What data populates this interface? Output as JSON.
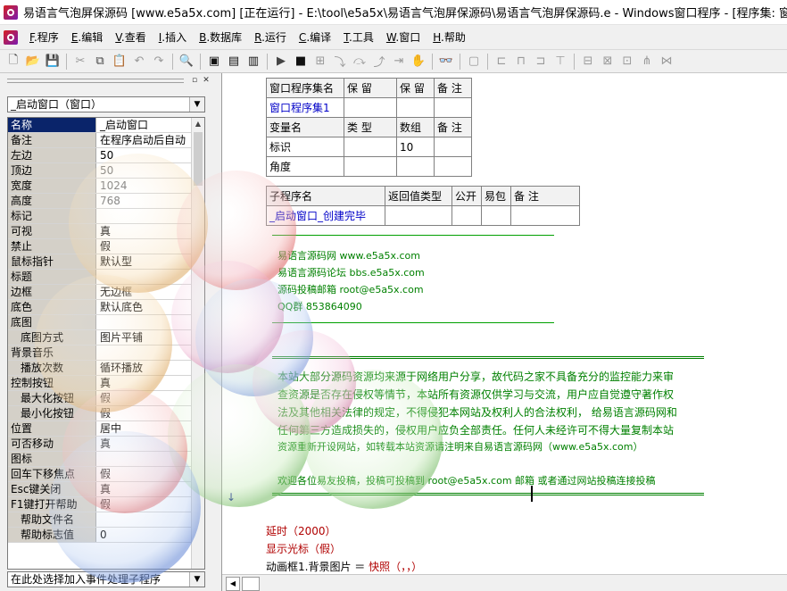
{
  "window": {
    "title": "易语言气泡屏保源码 [www.e5a5x.com] [正在运行] - E:\\tool\\e5a5x\\易语言气泡屏保源码\\易语言气泡屏保源码.e - Windows窗口程序 - [程序集: 窗口程"
  },
  "menu": [
    {
      "key": "F",
      "label": ".程序"
    },
    {
      "key": "E",
      "label": ".编辑"
    },
    {
      "key": "V",
      "label": ".查看"
    },
    {
      "key": "I",
      "label": ".插入"
    },
    {
      "key": "B",
      "label": ".数据库"
    },
    {
      "key": "R",
      "label": ".运行"
    },
    {
      "key": "C",
      "label": ".编译"
    },
    {
      "key": "T",
      "label": ".工具"
    },
    {
      "key": "W",
      "label": ".窗口"
    },
    {
      "key": "H",
      "label": ".帮助"
    }
  ],
  "toolbar_icons": [
    "new-file-icon",
    "open-file-icon",
    "save-icon",
    "cut-icon",
    "copy-icon",
    "paste-icon",
    "undo-icon",
    "redo-icon",
    "find-icon",
    "layout1-icon",
    "layout2-icon",
    "layout3-icon",
    "run-icon",
    "stop-icon",
    "step-icon",
    "step-into-icon",
    "step-over-icon",
    "step-out-icon",
    "run-to-cursor-icon",
    "hand-icon",
    "search-replace-icon",
    "form-icon",
    "align-left-icon",
    "align-center-icon",
    "align-right-icon",
    "align-top-icon",
    "same-width-icon",
    "same-height-icon",
    "same-size-icon",
    "h-space-icon",
    "v-space-icon"
  ],
  "props": {
    "object_combo": "_启动窗口（窗口）",
    "rows": [
      {
        "name": "名称",
        "value": "_启动窗口",
        "selected": true
      },
      {
        "name": "备注",
        "value": "在程序启动后自动"
      },
      {
        "name": "左边",
        "value": "50"
      },
      {
        "name": "顶边",
        "value": "50",
        "gray": true
      },
      {
        "name": "宽度",
        "value": "1024",
        "gray": true
      },
      {
        "name": "高度",
        "value": "768",
        "gray": true
      },
      {
        "name": "标记",
        "value": ""
      },
      {
        "name": "可视",
        "value": "真"
      },
      {
        "name": "禁止",
        "value": "假"
      },
      {
        "name": "鼠标指针",
        "value": "默认型"
      },
      {
        "name": "标题",
        "value": ""
      },
      {
        "name": "边框",
        "value": "无边框"
      },
      {
        "name": "底色",
        "value": "默认底色"
      },
      {
        "name": "底图",
        "value": ""
      },
      {
        "name": "底图方式",
        "value": "图片平铺",
        "sub": true
      },
      {
        "name": "背景音乐",
        "value": ""
      },
      {
        "name": "播放次数",
        "value": "循环播放",
        "sub": true
      },
      {
        "name": "控制按钮",
        "value": "真"
      },
      {
        "name": "最大化按钮",
        "value": "假",
        "sub": true
      },
      {
        "name": "最小化按钮",
        "value": "假",
        "sub": true
      },
      {
        "name": "位置",
        "value": "居中"
      },
      {
        "name": "可否移动",
        "value": "真"
      },
      {
        "name": "图标",
        "value": ""
      },
      {
        "name": "回车下移焦点",
        "value": "假"
      },
      {
        "name": "Esc键关闭",
        "value": "真"
      },
      {
        "name": "F1键打开帮助",
        "value": "假"
      },
      {
        "name": "帮助文件名",
        "value": "",
        "sub": true
      },
      {
        "name": "帮助标志值",
        "value": "0",
        "sub": true
      }
    ],
    "event_combo": "在此处选择加入事件处理子程序"
  },
  "editor": {
    "assembly_table": {
      "headers": [
        "窗口程序集名",
        "保 留",
        "保 留",
        "备 注"
      ],
      "row": [
        "窗口程序集1",
        "",
        "",
        ""
      ]
    },
    "var_table": {
      "headers": [
        "变量名",
        "类 型",
        "数组",
        "备 注"
      ],
      "rows": [
        [
          "标识",
          "",
          "10",
          ""
        ],
        [
          "角度",
          "",
          "",
          ""
        ]
      ]
    },
    "sub_table": {
      "headers": [
        "子程序名",
        "返回值类型",
        "公开",
        "易包",
        "备 注"
      ],
      "row": [
        "_启动窗口_创建完毕",
        "",
        "",
        "",
        ""
      ]
    },
    "comments1": [
      "易语言源码网    www.e5a5x.com",
      "易语言源码论坛    bbs.e5a5x.com",
      "源码投稿邮箱  root@e5a5x.com",
      "QQ群    853864090"
    ],
    "comments2": [
      "本站大部分源码资源均来源于网络用户分享，故代码之家不具备充分的监控能力来审",
      "查资源是否存在侵权等情节，本站所有资源仅供学习与交流，用户应自觉遵守著作权",
      "法及其他相关法律的规定，不得侵犯本网站及权利人的合法权利， 给易语言源码网和",
      "任何第三方造成损失的，侵权用户应负全部责任。任何人未经许可不得大量复制本站",
      "资源重新开设网站，如转载本站资源请注明来自易语言源码网（www.e5a5x.com）"
    ],
    "comment3": "欢迎各位易友投稿，投稿可投稿到    root@e5a5x.com  邮箱 或者通过网站投稿连接投稿",
    "code": [
      {
        "text": "延时（2000）",
        "color": "red"
      },
      {
        "text": "显示光标（假）",
        "color": "red"
      },
      {
        "text": "动画框1.背景图片 ＝ 快照（，，）",
        "color": "mixed"
      }
    ]
  },
  "colors": {
    "comment_green": "#008000",
    "keyword_blue": "#0000c8",
    "command_red": "#b00000",
    "selection": "#0a246a"
  }
}
